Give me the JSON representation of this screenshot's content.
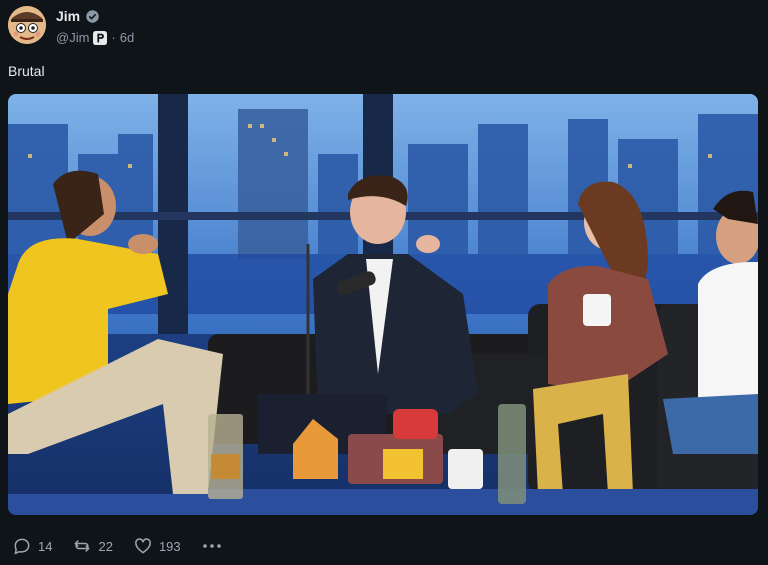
{
  "author": {
    "display_name": "Jim",
    "handle": "@Jim",
    "separator": "·",
    "time_ago": "6d",
    "verified": true,
    "avatar_icon": "cartoon-face-avatar",
    "badge_icon": "p-badge-icon"
  },
  "post": {
    "text": "Brutal",
    "media_description_icon": "photo-media"
  },
  "actions": {
    "replies": "14",
    "reposts": "22",
    "likes": "193",
    "reply_icon": "reply-icon",
    "repost_icon": "repost-icon",
    "like_icon": "heart-icon",
    "more_icon": "more-icon"
  },
  "colors": {
    "background": "#0f1419",
    "accent": "#1d9bf0",
    "muted": "#8b98a5"
  }
}
